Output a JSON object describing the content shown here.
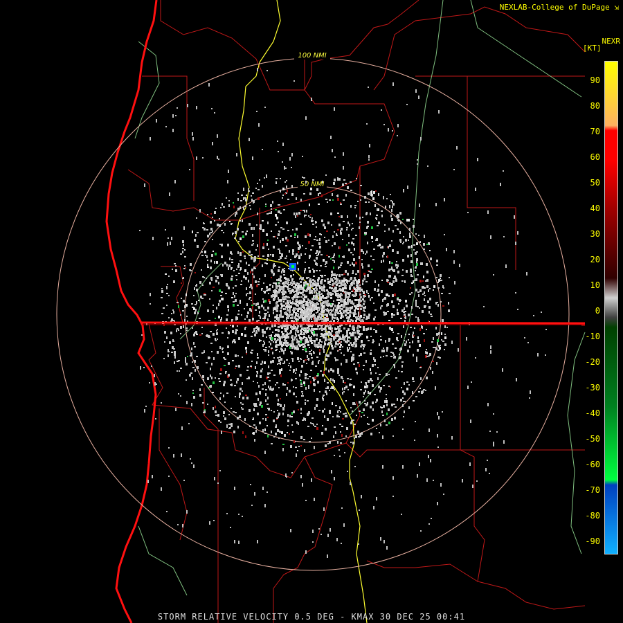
{
  "credit": "NEXLAB-College of DuPage",
  "product": "NEXR",
  "units": "[KT]",
  "ring_labels": [
    "100 NMI",
    "50 NMI"
  ],
  "legend": {
    "ticks": [
      "90",
      "80",
      "70",
      "60",
      "50",
      "40",
      "30",
      "20",
      "10",
      "0",
      "-10",
      "-20",
      "-30",
      "-40",
      "-50",
      "-60",
      "-70",
      "-80",
      "-90"
    ],
    "colors": {
      "top": "#ffff00",
      "light": "#ffb060",
      "red": "#ff0000",
      "darkred": "#300000",
      "gray": "#d0d0d0",
      "darkgreen": "#004000",
      "green": "#00ff40",
      "blue": "#0040c0",
      "cyan": "#10b0ff"
    }
  },
  "footer": "STORM RELATIVE VELOCITY 0.5 DEG - KMAX 30 DEC 25 00:41",
  "colors": {
    "background": "#000000",
    "ring": "#e8b0a0",
    "county": "#c01818",
    "highway": "#ffff30",
    "river": "#80d080",
    "coast": "#ff0000",
    "echo": "#c8c8c8"
  }
}
